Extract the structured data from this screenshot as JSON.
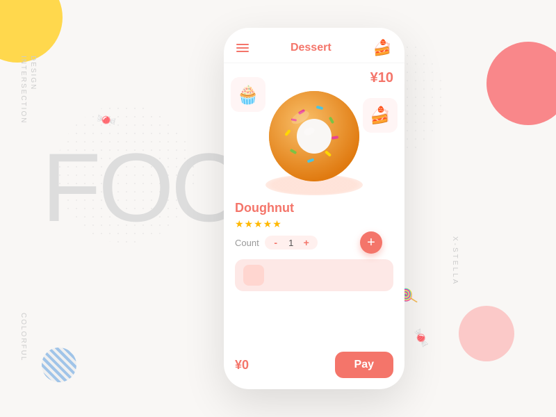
{
  "background": {
    "big_text": "FOO",
    "side_text_1": "INTERSECTION",
    "side_text_2": "DESIGN",
    "side_label_right": "X-STELLA",
    "side_label_bottom": "COLORFUL"
  },
  "phone": {
    "header": {
      "title": "Dessert",
      "menu_icon": "☰",
      "cart_icon": "🍰"
    },
    "product": {
      "price": "¥10",
      "name": "Doughnut",
      "rating_stars": "★★★★★",
      "count_label": "Count",
      "count_minus": "-",
      "count_value": "1",
      "count_plus": "+",
      "add_btn_label": "+"
    },
    "bottom": {
      "total": "¥0",
      "pay_label": "Pay"
    }
  }
}
